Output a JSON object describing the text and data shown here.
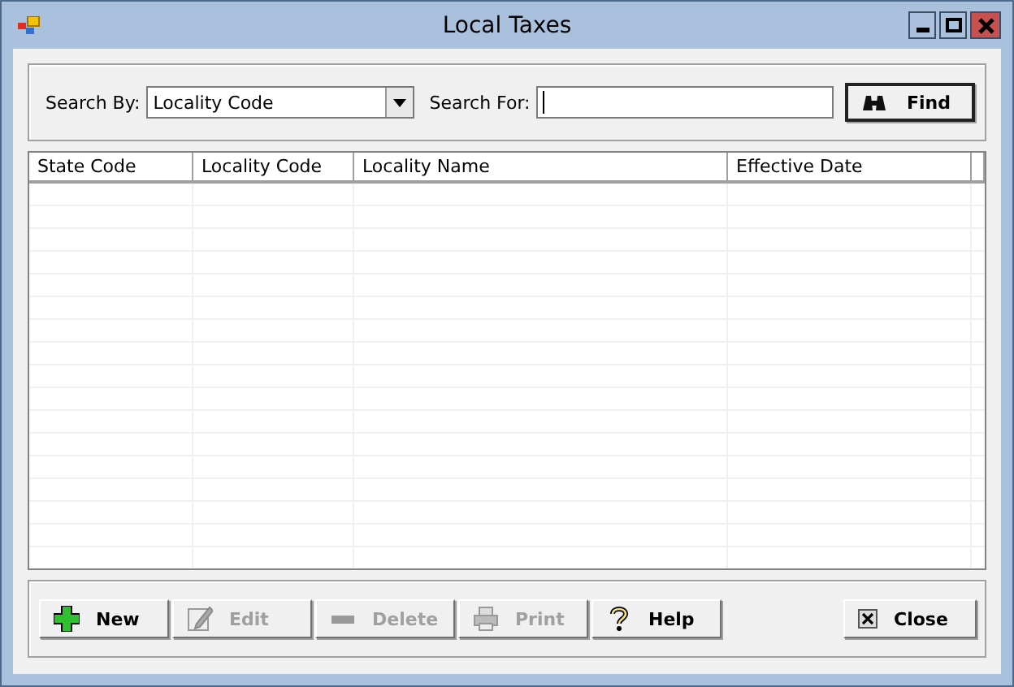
{
  "window": {
    "title": "Local Taxes"
  },
  "search": {
    "by_label": "Search By:",
    "by_value": "Locality Code",
    "for_label": "Search For:",
    "find_button": "Find"
  },
  "table": {
    "columns": [
      "State Code",
      "Locality Code",
      "Locality Name",
      "Effective Date"
    ]
  },
  "buttons": [
    {
      "label": "New",
      "kind": "new",
      "disabled": false
    },
    {
      "label": "Edit",
      "kind": "edit",
      "disabled": true
    },
    {
      "label": "Delete",
      "kind": "delete",
      "disabled": true
    },
    {
      "label": "Print",
      "kind": "print",
      "disabled": true
    },
    {
      "label": "Help",
      "kind": "help",
      "disabled": false
    }
  ],
  "close_button": "Close"
}
